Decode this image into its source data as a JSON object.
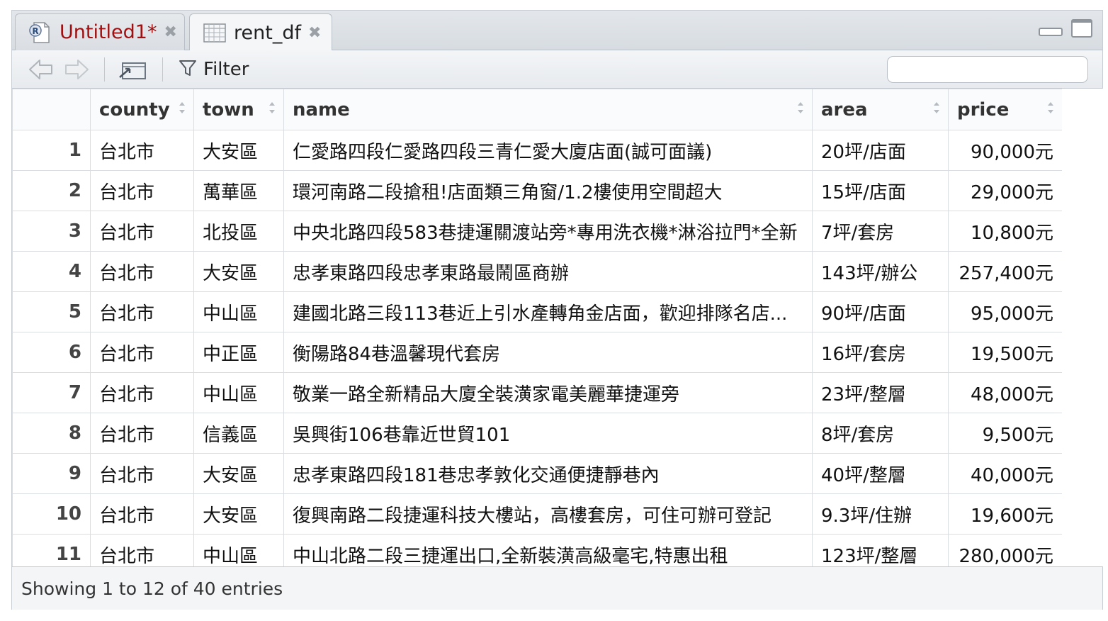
{
  "tabs": [
    {
      "label": "Untitled1*",
      "icon": "r-script-icon",
      "color": "#a01010"
    },
    {
      "label": "rent_df",
      "icon": "table-grid-icon"
    }
  ],
  "toolbar": {
    "filter_label": "Filter",
    "search_placeholder": ""
  },
  "table": {
    "columns": [
      "county",
      "town",
      "name",
      "area",
      "price"
    ],
    "rows": [
      {
        "n": "1",
        "county": "台北市",
        "town": "大安區",
        "name": "仁愛路四段仁愛路四段三青仁愛大廈店面(誠可面議)",
        "area": "20坪/店面",
        "price": "90,000元"
      },
      {
        "n": "2",
        "county": "台北市",
        "town": "萬華區",
        "name": "環河南路二段搶租!店面類三角窗/1.2樓使用空間超大",
        "area": "15坪/店面",
        "price": "29,000元"
      },
      {
        "n": "3",
        "county": "台北市",
        "town": "北投區",
        "name": "中央北路四段583巷捷運關渡站旁*專用洗衣機*淋浴拉門*全新",
        "area": "7坪/套房",
        "price": "10,800元"
      },
      {
        "n": "4",
        "county": "台北市",
        "town": "大安區",
        "name": "忠孝東路四段忠孝東路最鬧區商辦",
        "area": "143坪/辦公",
        "price": "257,400元"
      },
      {
        "n": "5",
        "county": "台北市",
        "town": "中山區",
        "name": "建國北路三段113巷近上引水產轉角金店面，歡迎排隊名店...",
        "area": "90坪/店面",
        "price": "95,000元"
      },
      {
        "n": "6",
        "county": "台北市",
        "town": "中正區",
        "name": "衡陽路84巷溫馨現代套房",
        "area": "16坪/套房",
        "price": "19,500元"
      },
      {
        "n": "7",
        "county": "台北市",
        "town": "中山區",
        "name": "敬業一路全新精品大廈全裝潢家電美麗華捷運旁",
        "area": "23坪/整層",
        "price": "48,000元"
      },
      {
        "n": "8",
        "county": "台北市",
        "town": "信義區",
        "name": "吳興街106巷靠近世貿101",
        "area": "8坪/套房",
        "price": "9,500元"
      },
      {
        "n": "9",
        "county": "台北市",
        "town": "大安區",
        "name": "忠孝東路四段181巷忠孝敦化交通便捷靜巷內",
        "area": "40坪/整層",
        "price": "40,000元"
      },
      {
        "n": "10",
        "county": "台北市",
        "town": "大安區",
        "name": "復興南路二段捷運科技大樓站，高樓套房，可住可辦可登記",
        "area": "9.3坪/住辦",
        "price": "19,600元"
      },
      {
        "n": "11",
        "county": "台北市",
        "town": "中山區",
        "name": "中山北路二段三捷運出口,全新裝潢高級毫宅,特惠出租",
        "area": "123坪/整層",
        "price": "280,000元"
      }
    ]
  },
  "footer": {
    "status": "Showing 1 to 12 of 40 entries"
  }
}
